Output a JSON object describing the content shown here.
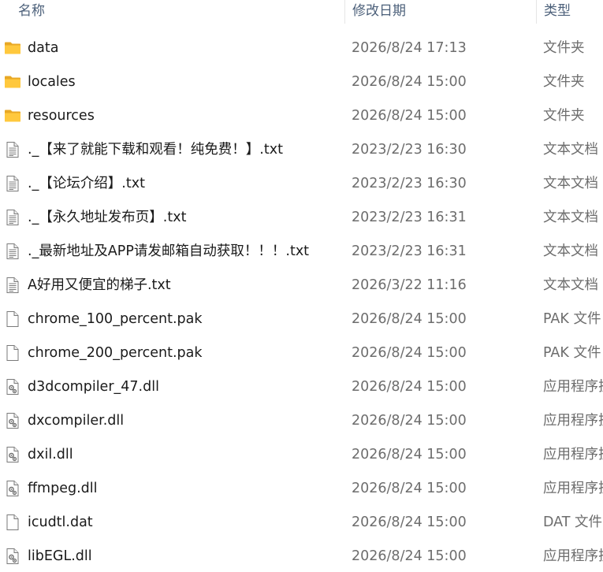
{
  "columns": {
    "name": "名称",
    "date": "修改日期",
    "type": "类型"
  },
  "files": [
    {
      "name": "data",
      "date": "2026/8/24 17:13",
      "type": "文件夹",
      "icon": "folder-icon"
    },
    {
      "name": "locales",
      "date": "2026/8/24 15:00",
      "type": "文件夹",
      "icon": "folder-icon"
    },
    {
      "name": "resources",
      "date": "2026/8/24 15:00",
      "type": "文件夹",
      "icon": "folder-icon"
    },
    {
      "name": "._【来了就能下载和观看！纯免费！】.txt",
      "date": "2023/2/23 16:30",
      "type": "文本文档",
      "icon": "text-file-icon"
    },
    {
      "name": "._【论坛介绍】.txt",
      "date": "2023/2/23 16:30",
      "type": "文本文档",
      "icon": "text-file-icon"
    },
    {
      "name": "._【永久地址发布页】.txt",
      "date": "2023/2/23 16:31",
      "type": "文本文档",
      "icon": "text-file-icon"
    },
    {
      "name": "._最新地址及APP请发邮箱自动获取！！！.txt",
      "date": "2023/2/23 16:31",
      "type": "文本文档",
      "icon": "text-file-icon"
    },
    {
      "name": "A好用又便宜的梯子.txt",
      "date": "2026/3/22 11:16",
      "type": "文本文档",
      "icon": "text-file-icon"
    },
    {
      "name": "chrome_100_percent.pak",
      "date": "2026/8/24 15:00",
      "type": "PAK 文件",
      "icon": "blank-file-icon"
    },
    {
      "name": "chrome_200_percent.pak",
      "date": "2026/8/24 15:00",
      "type": "PAK 文件",
      "icon": "blank-file-icon"
    },
    {
      "name": "d3dcompiler_47.dll",
      "date": "2026/8/24 15:00",
      "type": "应用程序扩展",
      "icon": "dll-file-icon"
    },
    {
      "name": "dxcompiler.dll",
      "date": "2026/8/24 15:00",
      "type": "应用程序扩展",
      "icon": "dll-file-icon"
    },
    {
      "name": "dxil.dll",
      "date": "2026/8/24 15:00",
      "type": "应用程序扩展",
      "icon": "dll-file-icon"
    },
    {
      "name": "ffmpeg.dll",
      "date": "2026/8/24 15:00",
      "type": "应用程序扩展",
      "icon": "dll-file-icon"
    },
    {
      "name": "icudtl.dat",
      "date": "2026/8/24 15:00",
      "type": "DAT 文件",
      "icon": "blank-file-icon"
    },
    {
      "name": "libEGL.dll",
      "date": "2026/8/24 15:00",
      "type": "应用程序扩展",
      "icon": "dll-file-icon"
    }
  ]
}
